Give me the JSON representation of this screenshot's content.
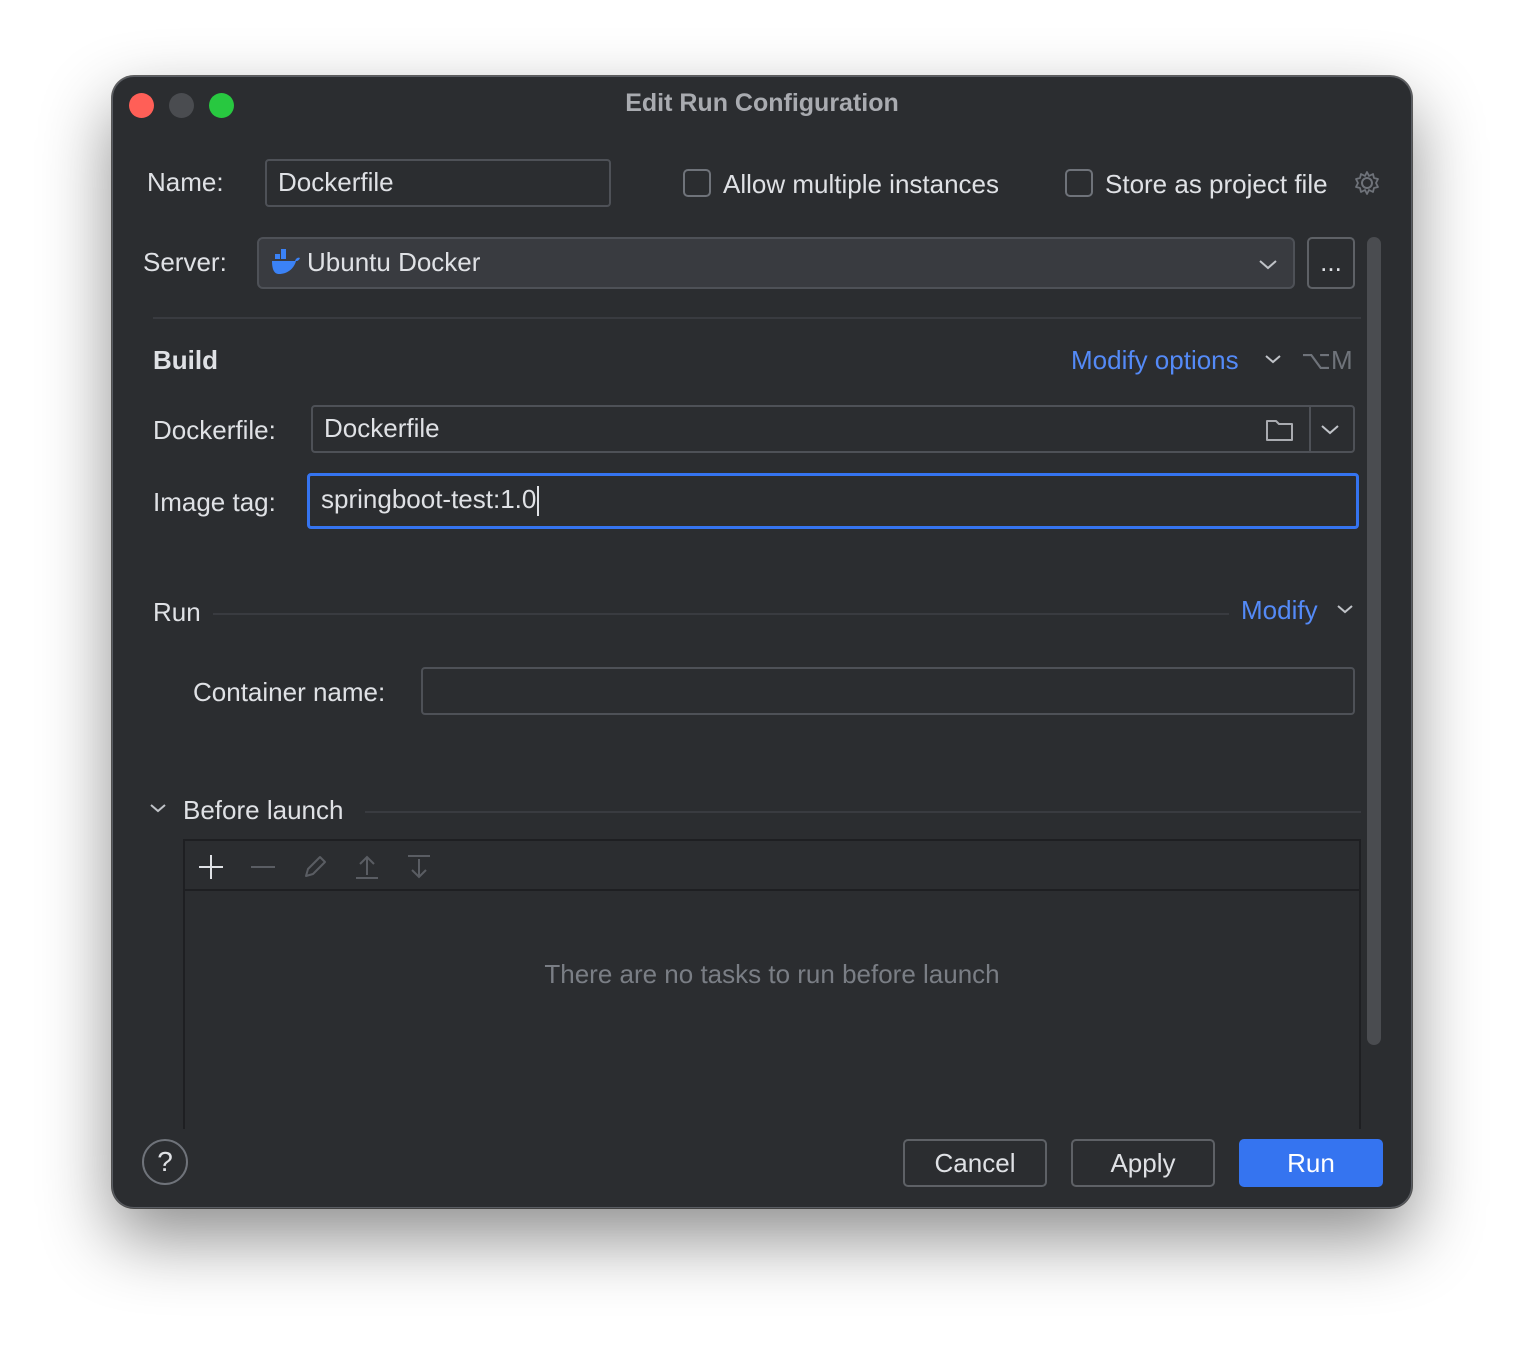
{
  "window": {
    "title": "Edit Run Configuration"
  },
  "name_row": {
    "label": "Name:",
    "value": "Dockerfile",
    "allow_multiple_label": "Allow multiple instances",
    "store_project_label": "Store as project file"
  },
  "server": {
    "label": "Server:",
    "value": "Ubuntu Docker",
    "browse_label": "..."
  },
  "build": {
    "heading": "Build",
    "modify_options_label": "Modify options",
    "modify_options_shortcut": "⌥M",
    "dockerfile_label": "Dockerfile:",
    "dockerfile_value": "Dockerfile",
    "image_tag_label": "Image tag:",
    "image_tag_value": "springboot-test:1.0"
  },
  "run": {
    "heading": "Run",
    "modify_label": "Modify",
    "container_name_label": "Container name:",
    "container_name_value": ""
  },
  "before_launch": {
    "heading": "Before launch",
    "empty_text": "There are no tasks to run before launch"
  },
  "footer": {
    "help_label": "?",
    "cancel_label": "Cancel",
    "apply_label": "Apply",
    "run_label": "Run"
  },
  "colors": {
    "background": "#2b2d30",
    "accent": "#3574f0",
    "link": "#548af7",
    "focus_border": "#3574f0"
  }
}
